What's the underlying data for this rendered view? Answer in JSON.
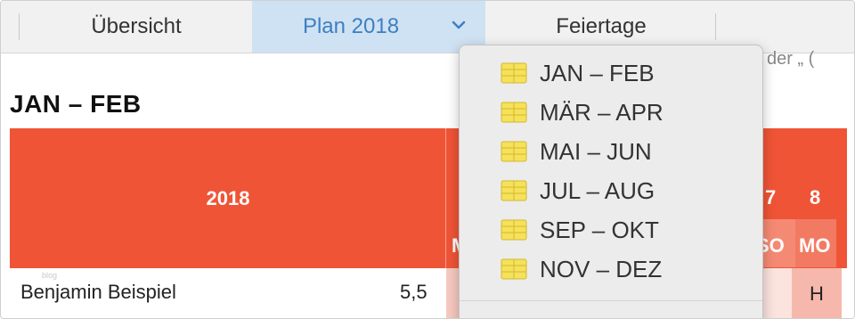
{
  "tabs": [
    {
      "label": "Übersicht"
    },
    {
      "label": "Plan 2018"
    },
    {
      "label": "Feiertage"
    }
  ],
  "background_fragment": "der „   (",
  "section_title": "JAN – FEB",
  "table": {
    "year": "2018",
    "day_numbers": [
      "7",
      "8"
    ],
    "day_names": [
      "M",
      "SO",
      "MO"
    ],
    "rows": [
      {
        "name": "Benjamin Beispiel",
        "value": "5,5",
        "cells": [
          "H"
        ],
        "watermark": "blog"
      }
    ]
  },
  "dropdown": {
    "items": [
      {
        "label": "JAN – FEB",
        "icon": "calendar-icon"
      },
      {
        "label": "MÄR – APR",
        "icon": "calendar-icon"
      },
      {
        "label": "MAI – JUN",
        "icon": "calendar-icon"
      },
      {
        "label": "JUL – AUG",
        "icon": "calendar-icon"
      },
      {
        "label": "SEP – OKT",
        "icon": "calendar-icon"
      },
      {
        "label": "NOV – DEZ",
        "icon": "calendar-icon"
      }
    ],
    "partial_text": "..."
  },
  "colors": {
    "header_red": "#f05436",
    "tab_active_bg": "#cfe2f3",
    "tab_active_text": "#3d7fc2",
    "icon_yellow": "#f5e15a"
  }
}
